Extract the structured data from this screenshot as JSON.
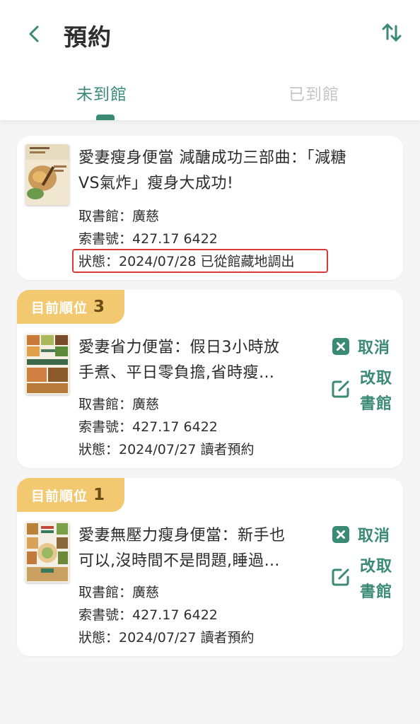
{
  "header": {
    "title": "預約",
    "back_icon": "chevron-left-icon",
    "sort_icon": "sort-arrows-icon",
    "accent_color": "#3a8a76"
  },
  "tabs": [
    {
      "label": "未到館",
      "active": true
    },
    {
      "label": "已到館",
      "active": false
    }
  ],
  "reservations": [
    {
      "title": "愛妻瘦身便當 減醣成功三部曲：「減糖VS氣炸」瘦身大成功!",
      "title_line1": "愛妻瘦身便當 減醣成功三部曲：「減糖",
      "title_line2": "VS氣炸」瘦身大成功!",
      "pickup_branch": "取書館：廣慈",
      "call_number": "索書號：427.17 6422",
      "status": "狀態：2024/07/28 已從館藏地調出",
      "highlighted": true
    },
    {
      "queue_label": "目前順位",
      "queue_position": "3",
      "title_line1": "愛妻省力便當：假日3小時放",
      "title_line2": "手煮、平日零負擔,省時瘦…",
      "pickup_branch": "取書館：廣慈",
      "call_number": "索書號：427.17 6422",
      "status": "狀態：2024/07/27 讀者預約",
      "cancel_label": "取消",
      "change_label_line1": "改取",
      "change_label_line2": "書館"
    },
    {
      "queue_label": "目前順位",
      "queue_position": "1",
      "title_line1": "愛妻無壓力瘦身便當：新手也",
      "title_line2": "可以,沒時間不是問題,睡過…",
      "pickup_branch": "取書館：廣慈",
      "call_number": "索書號：427.17 6422",
      "status": "狀態：2024/07/27 讀者預約",
      "cancel_label": "取消",
      "change_label_line1": "改取",
      "change_label_line2": "書館"
    }
  ]
}
